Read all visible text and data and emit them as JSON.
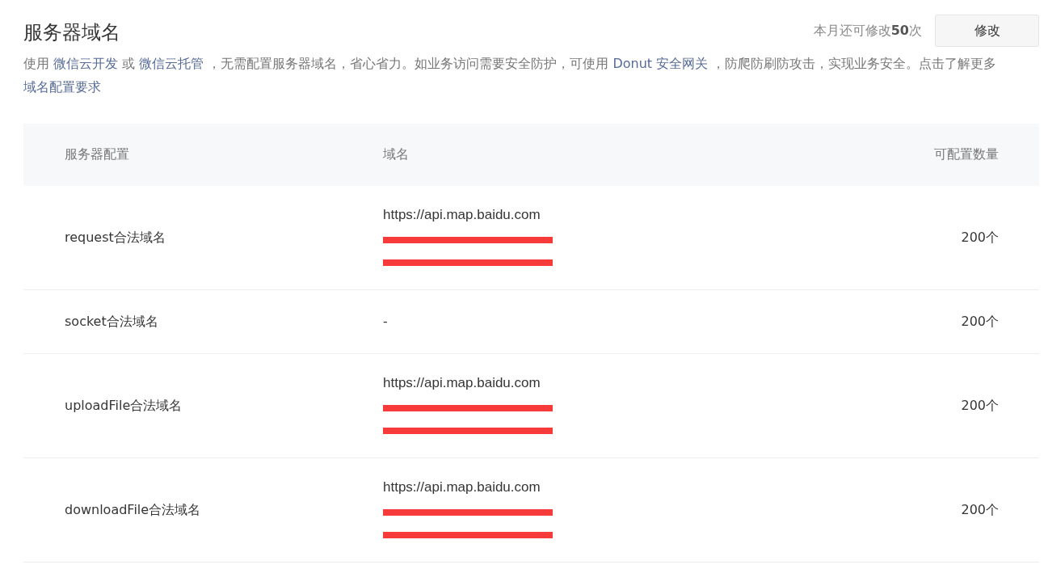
{
  "title": "服务器域名",
  "quota": "本月还可修改**50**次",
  "modify_button": "修改",
  "description": [
    {
      "kind": "text",
      "text": "使用 "
    },
    {
      "kind": "link",
      "text": "微信云开发"
    },
    {
      "kind": "text",
      "text": " 或 "
    },
    {
      "kind": "link",
      "text": "微信云托管"
    },
    {
      "kind": "text",
      "text": " ，无需配置服务器域名，省心省力。如业务访问需要安全防护，可使用 "
    },
    {
      "kind": "link",
      "text": "Donut 安全网关"
    },
    {
      "kind": "text",
      "text": " ，防爬防刷防攻击，实现业务安全。点击了解更多 "
    },
    {
      "kind": "link",
      "text": "域名配置要求"
    }
  ],
  "table": {
    "columns": [
      "服务器配置",
      "域名",
      "可配置数量"
    ],
    "rows": [
      {
        "config": "request合法域名",
        "domains": [
          {
            "kind": "text",
            "text": "https://api.map.baidu.com"
          },
          {
            "kind": "redacted"
          },
          {
            "kind": "redacted"
          }
        ],
        "count": "200个"
      },
      {
        "config": "socket合法域名",
        "domains": [
          {
            "kind": "text",
            "text": "-"
          }
        ],
        "count": "200个"
      },
      {
        "config": "uploadFile合法域名",
        "domains": [
          {
            "kind": "text",
            "text": "https://api.map.baidu.com"
          },
          {
            "kind": "redacted"
          },
          {
            "kind": "redacted"
          }
        ],
        "count": "200个"
      },
      {
        "config": "downloadFile合法域名",
        "domains": [
          {
            "kind": "text",
            "text": "https://api.map.baidu.com"
          },
          {
            "kind": "redacted"
          },
          {
            "kind": "redacted"
          }
        ],
        "count": "200个"
      }
    ]
  }
}
